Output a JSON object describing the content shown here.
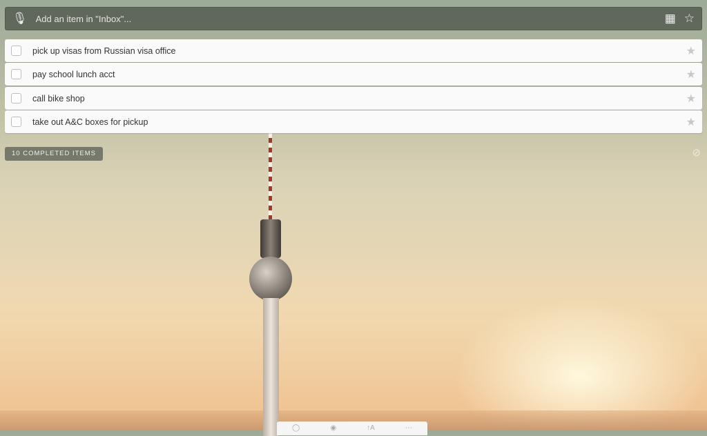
{
  "add_bar": {
    "placeholder": "Add an item in \"Inbox\"..."
  },
  "tasks": [
    {
      "title": "pick up visas from Russian visa office",
      "starred": false
    },
    {
      "title": "pay school lunch acct",
      "starred": false
    },
    {
      "title": "call bike shop",
      "starred": false
    },
    {
      "title": "take out A&C boxes for pickup",
      "starred": false
    }
  ],
  "completed": {
    "label": "10 COMPLETED ITEMS"
  }
}
